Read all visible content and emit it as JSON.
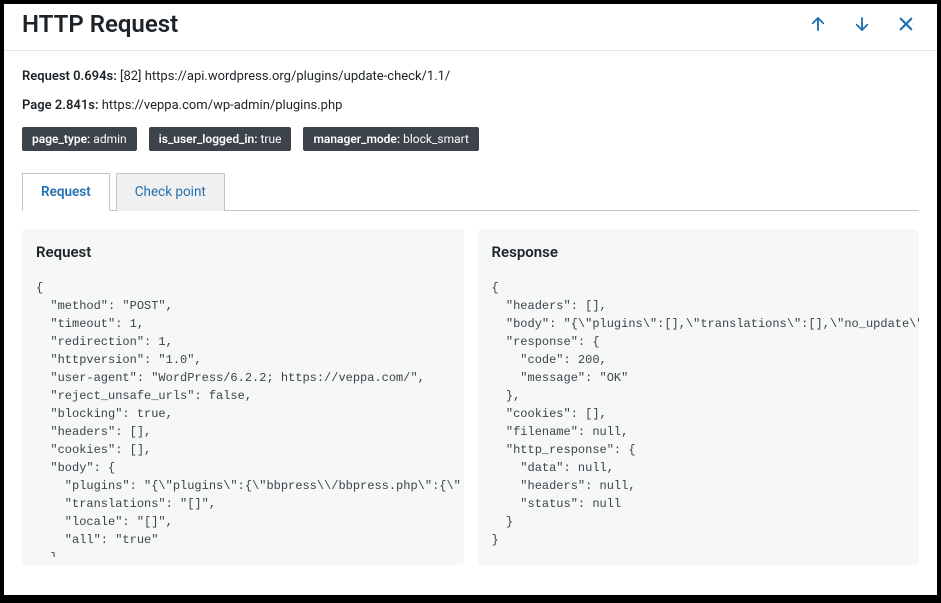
{
  "header": {
    "title": "HTTP Request"
  },
  "request_line": {
    "label": "Request 0.694s:",
    "id": "[82]",
    "url": "https://api.wordpress.org/plugins/update-check/1.1/"
  },
  "page_line": {
    "label": "Page 2.841s:",
    "url": "https://veppa.com/wp-admin/plugins.php"
  },
  "tags": [
    {
      "key": "page_type:",
      "value": " admin"
    },
    {
      "key": "is_user_logged_in:",
      "value": " true"
    },
    {
      "key": "manager_mode:",
      "value": " block_smart"
    }
  ],
  "tabs": {
    "request": "Request",
    "checkpoint": "Check point"
  },
  "panels": {
    "request": {
      "title": "Request",
      "code": "{\n  \"method\": \"POST\",\n  \"timeout\": 1,\n  \"redirection\": 1,\n  \"httpversion\": \"1.0\",\n  \"user-agent\": \"WordPress/6.2.2; https://veppa.com/\",\n  \"reject_unsafe_urls\": false,\n  \"blocking\": true,\n  \"headers\": [],\n  \"cookies\": [],\n  \"body\": {\n    \"plugins\": \"{\\\"plugins\\\":{\\\"bbpress\\\\/bbpress.php\\\":{\\\"\n    \"translations\": \"[]\",\n    \"locale\": \"[]\",\n    \"all\": \"true\"\n  }"
    },
    "response": {
      "title": "Response",
      "code": "{\n  \"headers\": [],\n  \"body\": \"{\\\"plugins\\\":[],\\\"translations\\\":[],\\\"no_update\\\":{\n  \"response\": {\n    \"code\": 200,\n    \"message\": \"OK\"\n  },\n  \"cookies\": [],\n  \"filename\": null,\n  \"http_response\": {\n    \"data\": null,\n    \"headers\": null,\n    \"status\": null\n  }\n}"
    }
  }
}
